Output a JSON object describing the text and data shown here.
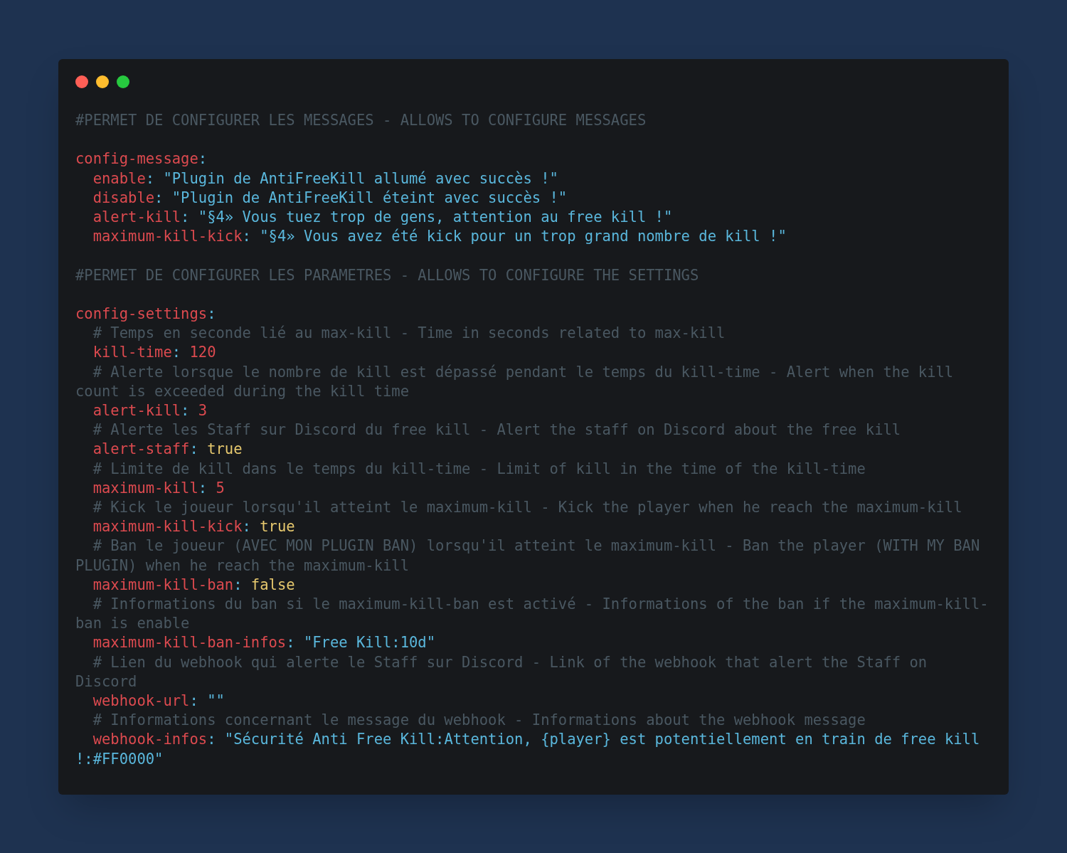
{
  "code": [
    {
      "kind": "comment",
      "text": "#PERMET DE CONFIGURER LES MESSAGES - ALLOWS TO CONFIGURE MESSAGES"
    },
    {
      "kind": "blank"
    },
    {
      "kind": "entry",
      "key": "config-message",
      "colon": ":",
      "children": [
        {
          "kind": "entry",
          "key": "enable",
          "colon": ":",
          "value": {
            "kind": "string",
            "text": "\"Plugin de AntiFreeKill allumé avec succès !\""
          }
        },
        {
          "kind": "entry",
          "key": "disable",
          "colon": ":",
          "value": {
            "kind": "string",
            "text": "\"Plugin de AntiFreeKill éteint avec succès !\""
          }
        },
        {
          "kind": "entry",
          "key": "alert-kill",
          "colon": ":",
          "value": {
            "kind": "string",
            "text": "\"§4» Vous tuez trop de gens, attention au free kill !\""
          }
        },
        {
          "kind": "entry",
          "key": "maximum-kill-kick",
          "colon": ":",
          "value": {
            "kind": "string",
            "text": "\"§4» Vous avez été kick pour un trop grand nombre de kill !\""
          }
        }
      ]
    },
    {
      "kind": "blank"
    },
    {
      "kind": "comment",
      "text": "#PERMET DE CONFIGURER LES PARAMETRES - ALLOWS TO CONFIGURE THE SETTINGS"
    },
    {
      "kind": "blank"
    },
    {
      "kind": "entry",
      "key": "config-settings",
      "colon": ":",
      "children": [
        {
          "kind": "comment",
          "text": "# Temps en seconde lié au max-kill - Time in seconds related to max-kill"
        },
        {
          "kind": "entry",
          "key": "kill-time",
          "colon": ":",
          "value": {
            "kind": "number",
            "text": "120"
          }
        },
        {
          "kind": "comment",
          "text": "# Alerte lorsque le nombre de kill est dépassé pendant le temps du kill-time - Alert when the kill count is exceeded during the kill time"
        },
        {
          "kind": "entry",
          "key": "alert-kill",
          "colon": ":",
          "value": {
            "kind": "number",
            "text": "3"
          }
        },
        {
          "kind": "comment",
          "text": "# Alerte les Staff sur Discord du free kill - Alert the staff on Discord about the free kill"
        },
        {
          "kind": "entry",
          "key": "alert-staff",
          "colon": ":",
          "value": {
            "kind": "boolean",
            "text": "true"
          }
        },
        {
          "kind": "comment",
          "text": "# Limite de kill dans le temps du kill-time - Limit of kill in the time of the kill-time"
        },
        {
          "kind": "entry",
          "key": "maximum-kill",
          "colon": ":",
          "value": {
            "kind": "number",
            "text": "5"
          }
        },
        {
          "kind": "comment",
          "text": "# Kick le joueur lorsqu'il atteint le maximum-kill - Kick the player when he reach the maximum-kill"
        },
        {
          "kind": "entry",
          "key": "maximum-kill-kick",
          "colon": ":",
          "value": {
            "kind": "boolean",
            "text": "true"
          }
        },
        {
          "kind": "comment",
          "text": "# Ban le joueur (AVEC MON PLUGIN BAN) lorsqu'il atteint le maximum-kill - Ban the player (WITH MY BAN PLUGIN) when he reach the maximum-kill"
        },
        {
          "kind": "entry",
          "key": "maximum-kill-ban",
          "colon": ":",
          "value": {
            "kind": "boolean",
            "text": "false"
          }
        },
        {
          "kind": "comment",
          "text": "# Informations du ban si le maximum-kill-ban est activé - Informations of the ban if the maximum-kill-ban is enable"
        },
        {
          "kind": "entry",
          "key": "maximum-kill-ban-infos",
          "colon": ":",
          "value": {
            "kind": "string",
            "text": "\"Free Kill:10d\""
          }
        },
        {
          "kind": "comment",
          "text": "# Lien du webhook qui alerte le Staff sur Discord - Link of the webhook that alert the Staff on Discord"
        },
        {
          "kind": "entry",
          "key": "webhook-url",
          "colon": ":",
          "value": {
            "kind": "string",
            "text": "\"\""
          }
        },
        {
          "kind": "comment",
          "text": "# Informations concernant le message du webhook - Informations about the webhook message"
        },
        {
          "kind": "entry",
          "key": "webhook-infos",
          "colon": ":",
          "value": {
            "kind": "string",
            "text": "\"Sécurité Anti Free Kill:Attention, {player} est potentiellement en train de free kill !:#FF0000\""
          }
        }
      ]
    }
  ]
}
